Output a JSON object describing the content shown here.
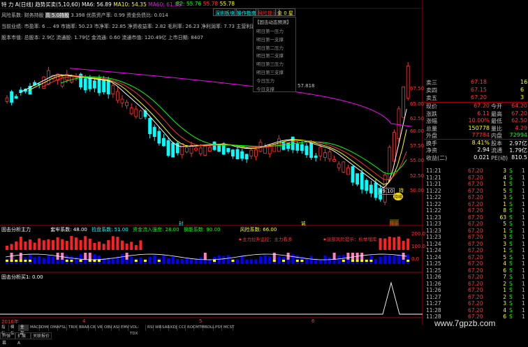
{
  "header": {
    "title": "特 力 A(日线)",
    "indicator_name": "趋势买卖(5,10,60)",
    "ma5": "MA6: 56.89",
    "ma10": "MA10: 54.35",
    "ma60": "MA60: 61.89",
    "b2": "B2: 55.76",
    "b3": "55.78",
    "b4": "55.78"
  },
  "buttons": {
    "sector": "深圳板块",
    "guide": "操作指南",
    "tips": "风险提示",
    "panel": "金 0 星"
  },
  "info": {
    "row1": "风险系数: 财务持股",
    "row1b": "高 5.0持股",
    "row1c": "3.398 优质资产率: 0.99 资金负债比: 0.014",
    "row2": "当前业绩: 市盈率: 6 ... 49 市销率: 50.23 市净率: 22.85 净资收益率: 2.82 毛利率: 26.23 净利润率: 7.73 主营利润率: 8.12",
    "row3": "股本市值: 总股本: 2.9亿 流通股: 1.79亿 金流通: 0.60 流通市值: 120.49亿 上市日期: 8407"
  },
  "dropdown": {
    "title": "【固击动态预测】",
    "items": [
      "明日第一压力",
      "明日第一支撑",
      "明日第二压力",
      "明日第二支撑",
      "明日第三压力",
      "明日第三支撑",
      "今日压力",
      "今日支撑"
    ],
    "today_support_value": "57.818"
  },
  "price_axis": [
    "67.50",
    "65.00",
    "62.50",
    "60.00",
    "57.50",
    "55.00",
    "52.50",
    "50.00"
  ],
  "candle_markers": {
    "low_label": "49.10",
    "buy": "持",
    "sell": "持续"
  },
  "top_markers": [
    "封",
    "诚",
    "降杀"
  ],
  "mid_panel": {
    "title": "固击分析主力",
    "a": "套牢系数: 48.00",
    "b": "拉盘系数: 51.00",
    "c": "资金流入强度: 28.00",
    "d": "换能系数: 90.00",
    "e": "风险系数: 66.00",
    "note1": "★主力拉升监控：主力看多",
    "note2": "★底部风险提示：检举增库",
    "axis": [
      "200.0",
      "100.0",
      "0.0"
    ]
  },
  "low_panel": {
    "title": "固击分析买1: 0.00"
  },
  "x_axis": {
    "year": "2016年",
    "m4": "4",
    "m5": "5",
    "m6": "6"
  },
  "quote": {
    "ask3": {
      "label": "卖三",
      "price": "67.18",
      "vol": "16"
    },
    "ask4": {
      "label": "卖四",
      "price": "67.15",
      "vol": "6"
    },
    "ask5": {
      "label": "卖五",
      "price": "67.20",
      "vol": "3"
    },
    "rows": [
      {
        "l": "现价",
        "v": "67.20",
        "l2": "今开",
        "v2": "64.20"
      },
      {
        "l": "涨跌",
        "v": "6.11",
        "l2": "最高",
        "v2": "67.20"
      },
      {
        "l": "涨幅",
        "v": "10.00%",
        "l2": "最低",
        "v2": "62.50"
      },
      {
        "l": "总量",
        "v": "150778",
        "l2": "量比",
        "v2": "4.29"
      },
      {
        "l": "外盘",
        "v": "77784",
        "l2": "内盘",
        "v2": "72994"
      },
      {
        "l": "换手",
        "v": "8.41%",
        "l2": "股本",
        "v2": "2.97亿"
      },
      {
        "l": "净资",
        "v": "2.94",
        "l2": "流通",
        "v2": "1.79亿"
      },
      {
        "l": "收益(二)",
        "v": "0.021",
        "l2": "PE(动)",
        "v2": "810.5"
      }
    ]
  },
  "ticks": [
    {
      "t": "11:21",
      "p": "67.20",
      "v": "3",
      "bs": "S",
      "n": "1"
    },
    {
      "t": "11:21",
      "p": "67.20",
      "v": "4",
      "bs": "S",
      "n": "1"
    },
    {
      "t": "11:21",
      "p": "67.20",
      "v": "1",
      "bs": "S",
      "n": "1"
    },
    {
      "t": "11:22",
      "p": "67.20",
      "v": "5",
      "bs": "S",
      "n": "1"
    },
    {
      "t": "11:22",
      "p": "67.20",
      "v": "3",
      "bs": "S",
      "n": "1"
    },
    {
      "t": "11:22",
      "p": "67.20",
      "v": "1",
      "bs": "S",
      "n": "1"
    },
    {
      "t": "11:22",
      "p": "67.20",
      "v": "8",
      "bs": "S",
      "n": "1"
    },
    {
      "t": "11:23",
      "p": "67.20",
      "v": "63",
      "bs": "S",
      "n": "1"
    },
    {
      "t": "11:23",
      "p": "67.20",
      "v": "5",
      "bs": "S",
      "n": "1"
    },
    {
      "t": "11:23",
      "p": "67.20",
      "v": "1",
      "bs": "S",
      "n": "1"
    },
    {
      "t": "11:23",
      "p": "67.20",
      "v": "3",
      "bs": "S",
      "n": "1"
    },
    {
      "t": "11:24",
      "p": "67.20",
      "v": "3",
      "bs": "S",
      "n": "1"
    },
    {
      "t": "11:24",
      "p": "67.20",
      "v": "1",
      "bs": "S",
      "n": "1"
    },
    {
      "t": "11:24",
      "p": "67.20",
      "v": "5",
      "bs": "S",
      "n": "1"
    },
    {
      "t": "11:25",
      "p": "67.20",
      "v": "4",
      "bs": "S",
      "n": "1"
    },
    {
      "t": "11:25",
      "p": "67.20",
      "v": "6",
      "bs": "S",
      "n": "1"
    },
    {
      "t": "11:26",
      "p": "67.20",
      "v": "7",
      "bs": "S",
      "n": "1"
    },
    {
      "t": "11:26",
      "p": "67.20",
      "v": "2",
      "bs": "S",
      "n": "1"
    },
    {
      "t": "11:26",
      "p": "67.20",
      "v": "1",
      "bs": "S",
      "n": "1"
    },
    {
      "t": "11:27",
      "p": "67.20",
      "v": "2",
      "bs": "S",
      "n": "1"
    },
    {
      "t": "11:27",
      "p": "67.20",
      "v": "3",
      "bs": "S",
      "n": "1"
    },
    {
      "t": "11:28",
      "p": "67.20",
      "v": "4",
      "bs": "S",
      "n": "1"
    },
    {
      "t": "11:28",
      "p": "67.20",
      "v": "6",
      "bs": "S",
      "n": "1"
    },
    {
      "t": "11:29",
      "p": "67.20",
      "v": "3",
      "bs": "S",
      "n": "1"
    },
    {
      "t": "11:29",
      "p": "67.20",
      "v": "1",
      "bs": "S",
      "n": "1"
    }
  ],
  "tabs": [
    "指标",
    "模板",
    "全部",
    "MACD",
    "DMI",
    "DMA",
    "FSL",
    "TRIX",
    "BRAR",
    "CR",
    "VR",
    "OBV",
    "ASI",
    "EMV",
    "VOL-TDX",
    "RSI",
    "WR",
    "SAR",
    "KDJ",
    "CCI",
    "ROC",
    "MTM",
    "BOLL",
    "PSY",
    "MCST"
  ],
  "bottom_buttons": [
    "开弹幕",
    "扩展A",
    "关联报价"
  ],
  "watermark": "www.7gpzb.com",
  "colors": {
    "up": "#ff3232",
    "down": "#00ffff",
    "ma5": "#ffffff",
    "ma10": "#ffff00",
    "ma60": "#ff00ff",
    "green": "#00ff00"
  }
}
